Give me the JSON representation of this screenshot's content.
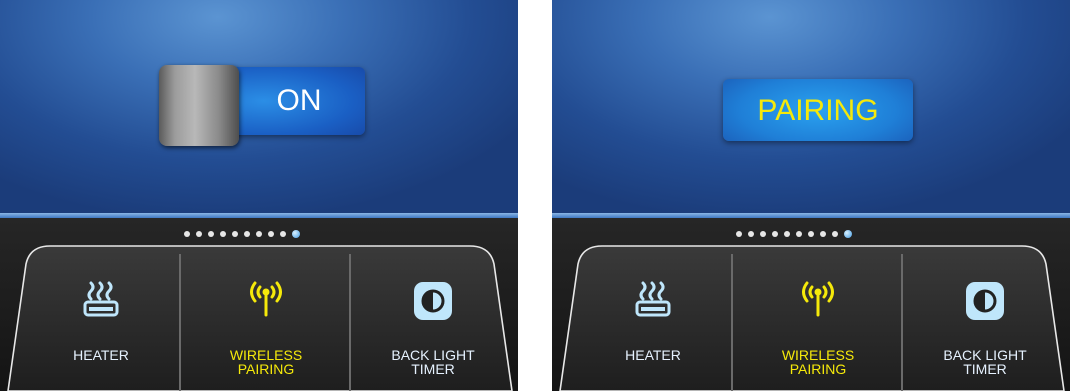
{
  "colors": {
    "screen_blue": "#2f5fa8",
    "accent_yellow": "#f5e90a",
    "icon_cyan": "#bfe6fb",
    "label_white": "#e6f2ff",
    "active_dot": "#6fb6ee"
  },
  "left_panel": {
    "toggle": {
      "label": "ON",
      "state": "on"
    },
    "page_indicator": {
      "total": 10,
      "active_index": 9
    },
    "menu": [
      {
        "id": "heater",
        "lines": [
          "HEATER"
        ],
        "icon": "heater-icon",
        "active": false
      },
      {
        "id": "wireless-pairing",
        "lines": [
          "WIRELESS",
          "PAIRING"
        ],
        "icon": "wireless-antenna-icon",
        "active": true
      },
      {
        "id": "back-light-timer",
        "lines": [
          "BACK LIGHT",
          "TIMER"
        ],
        "icon": "contrast-icon",
        "active": false
      }
    ]
  },
  "right_panel": {
    "status_button": {
      "label": "PAIRING"
    },
    "page_indicator": {
      "total": 10,
      "active_index": 9
    },
    "menu": [
      {
        "id": "heater",
        "lines": [
          "HEATER"
        ],
        "icon": "heater-icon",
        "active": false
      },
      {
        "id": "wireless-pairing",
        "lines": [
          "WIRELESS",
          "PAIRING"
        ],
        "icon": "wireless-antenna-icon",
        "active": true
      },
      {
        "id": "back-light-timer",
        "lines": [
          "BACK LIGHT",
          "TIMER"
        ],
        "icon": "contrast-icon",
        "active": false
      }
    ]
  }
}
